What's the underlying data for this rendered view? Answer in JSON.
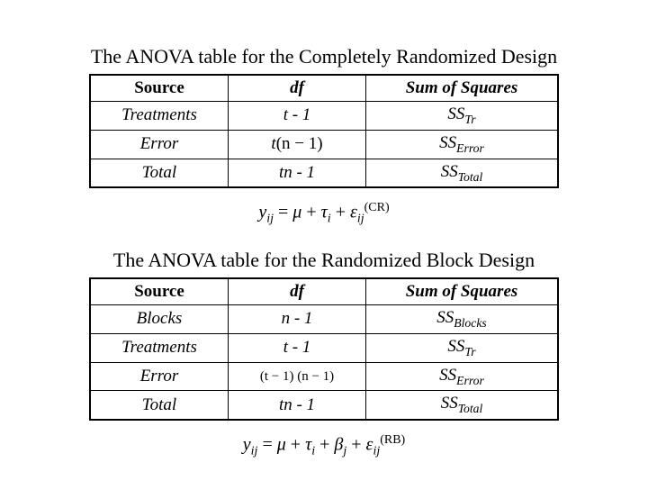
{
  "section1": {
    "title": "The ANOVA table for the Completely Randomized Design",
    "headers": {
      "source": "Source",
      "df": "df",
      "ss": "Sum of Squares"
    },
    "rows": {
      "treatments": {
        "source": "Treatments",
        "df": "t - 1",
        "ss_base": "SS",
        "ss_sub": "Tr"
      },
      "error": {
        "source": "Error",
        "df_pre": "t",
        "df_post": "(n − 1)",
        "ss_base": "SS",
        "ss_sub": "Error"
      },
      "total": {
        "source": "Total",
        "df": "tn - 1",
        "ss_base": "SS",
        "ss_sub": "Total"
      }
    },
    "equation": {
      "y": "y",
      "y_sub": "ij",
      "mu": "μ",
      "tau": "τ",
      "tau_sub": "i",
      "eps": "ε",
      "eps_sub": "ij",
      "eps_sup": "(CR)"
    }
  },
  "section2": {
    "title": "The ANOVA table for the Randomized Block Design",
    "headers": {
      "source": "Source",
      "df": "df",
      "ss": "Sum of Squares"
    },
    "rows": {
      "blocks": {
        "source": "Blocks",
        "df": "n - 1",
        "ss_base": "SS",
        "ss_sub": "Blocks"
      },
      "treatments": {
        "source": "Treatments",
        "df": "t - 1",
        "ss_base": "SS",
        "ss_sub": "Tr"
      },
      "error": {
        "source": "Error",
        "df": "(t − 1) (n − 1)",
        "ss_base": "SS",
        "ss_sub": "Error"
      },
      "total": {
        "source": "Total",
        "df": "tn - 1",
        "ss_base": "SS",
        "ss_sub": "Total"
      }
    },
    "equation": {
      "y": "y",
      "y_sub": "ij",
      "mu": "μ",
      "tau": "τ",
      "tau_sub": "i",
      "beta": "β",
      "beta_sub": "j",
      "eps": "ε",
      "eps_sub": "ij",
      "eps_sup": "(RB)"
    }
  }
}
